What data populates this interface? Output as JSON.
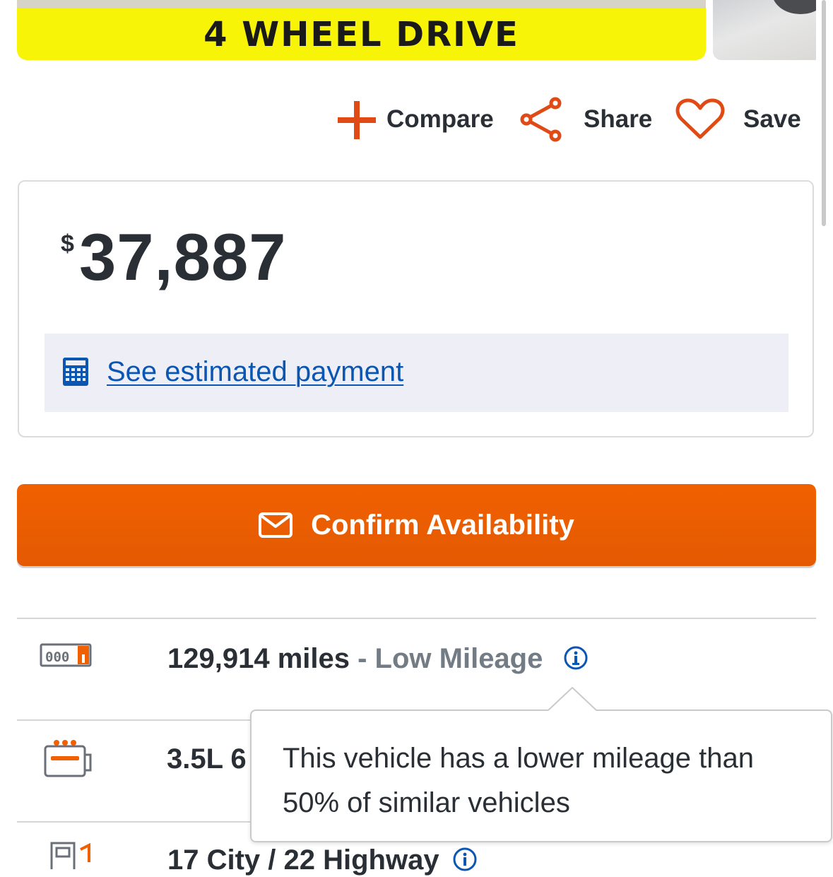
{
  "gallery": {
    "banner_text": "4 WHEEL DRIVE"
  },
  "actions": {
    "compare_label": "Compare",
    "share_label": "Share",
    "save_label": "Save"
  },
  "price": {
    "currency": "$",
    "amount": "37,887",
    "payment_link": "See estimated payment"
  },
  "cta": {
    "label": "Confirm Availability"
  },
  "specs": [
    {
      "icon": "odometer-icon",
      "value": "129,914 miles",
      "separator": " - ",
      "badge": "Low Mileage",
      "info": true
    },
    {
      "icon": "engine-icon",
      "value": "3.5L 6"
    },
    {
      "icon": "fuel-pump-icon",
      "value": "17 City / 22 Highway",
      "info": true
    }
  ],
  "tooltip": {
    "text": "This vehicle has a lower mileage than 50% of similar vehicles"
  },
  "colors": {
    "accent": "#e04a14",
    "cta": "#f06000",
    "link": "#0b56b2",
    "banner": "#f8f408"
  }
}
